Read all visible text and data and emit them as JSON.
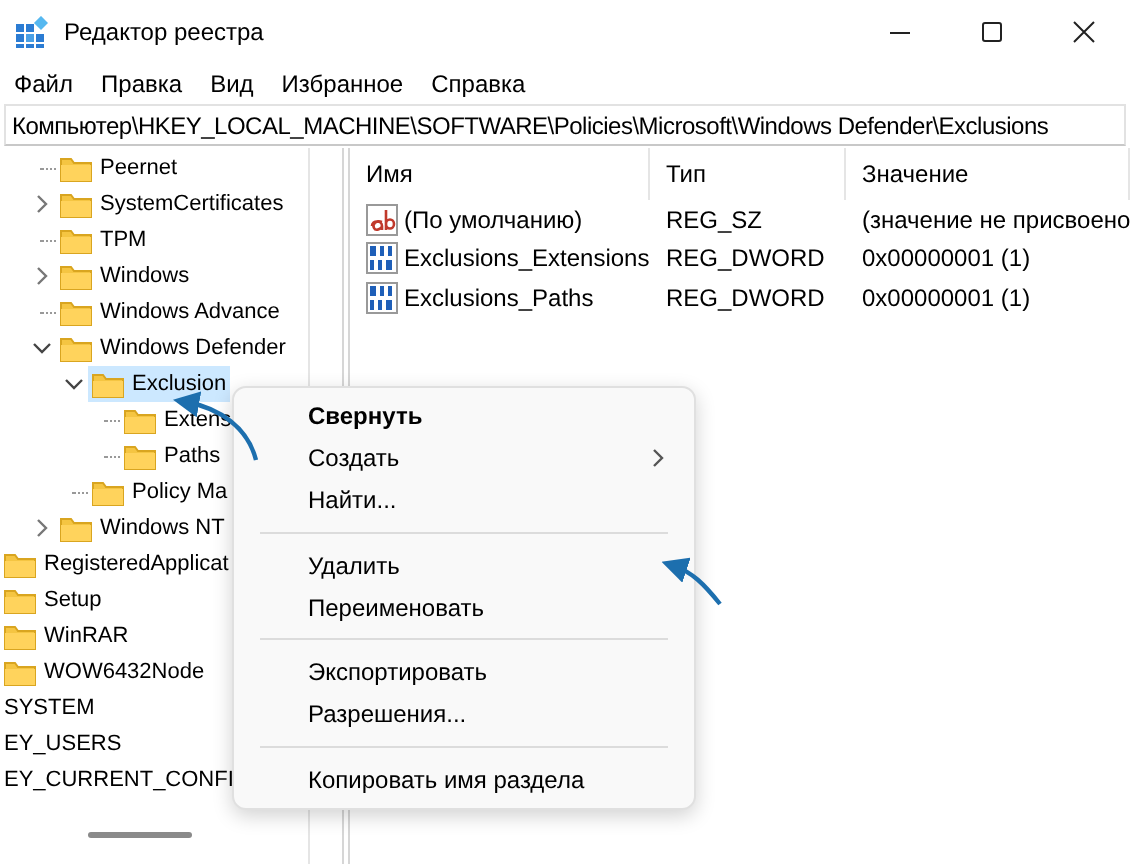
{
  "window": {
    "title": "Редактор реестра"
  },
  "menu_bar": [
    "Файл",
    "Правка",
    "Вид",
    "Избранное",
    "Справка"
  ],
  "address": "Компьютер\\HKEY_LOCAL_MACHINE\\SOFTWARE\\Policies\\Microsoft\\Windows Defender\\Exclusions",
  "tree": {
    "microsoft_keys": [
      {
        "label": "Peernet",
        "has_children": false,
        "selected": false
      },
      {
        "label": "SystemCertificates",
        "has_children": true,
        "expanded": false,
        "selected": false
      },
      {
        "label": "TPM",
        "has_children": false,
        "selected": false
      },
      {
        "label": "Windows",
        "has_children": true,
        "expanded": false,
        "selected": false
      },
      {
        "label": "Windows Advance",
        "has_children": false,
        "selected": false
      },
      {
        "label": "Windows Defender",
        "has_children": true,
        "expanded": true,
        "selected": false,
        "children": [
          {
            "label": "Exclusion",
            "has_children": true,
            "expanded": true,
            "selected": true,
            "children": [
              {
                "label": "Extens",
                "has_children": false,
                "selected": false
              },
              {
                "label": "Paths",
                "has_children": false,
                "selected": false
              }
            ]
          },
          {
            "label": "Policy Ma",
            "has_children": false,
            "selected": false
          }
        ]
      },
      {
        "label": "Windows NT",
        "has_children": true,
        "expanded": false,
        "selected": false
      }
    ],
    "software_keys": [
      {
        "label": "RegisteredApplicat",
        "selected": false
      },
      {
        "label": "Setup",
        "selected": false
      },
      {
        "label": "WinRAR",
        "selected": false
      },
      {
        "label": "WOW6432Node",
        "selected": false
      }
    ],
    "root_keys": [
      {
        "label": "SYSTEM",
        "selected": false
      },
      {
        "label": "EY_USERS",
        "selected": false
      },
      {
        "label": "EY_CURRENT_CONFI",
        "selected": false
      }
    ]
  },
  "values": {
    "columns": [
      "Имя",
      "Тип",
      "Значение"
    ],
    "rows": [
      {
        "kind": "string",
        "name": "(По умолчанию)",
        "type": "REG_SZ",
        "data": "(значение не присвоено"
      },
      {
        "kind": "dword",
        "name": "Exclusions_Extensions",
        "type": "REG_DWORD",
        "data": "0x00000001 (1)"
      },
      {
        "kind": "dword",
        "name": "Exclusions_Paths",
        "type": "REG_DWORD",
        "data": "0x00000001 (1)"
      }
    ]
  },
  "context_menu": [
    {
      "kind": "item",
      "label": "Свернуть",
      "default": true,
      "submenu": false
    },
    {
      "kind": "item",
      "label": "Создать",
      "default": false,
      "submenu": true
    },
    {
      "kind": "item",
      "label": "Найти...",
      "default": false,
      "submenu": false
    },
    {
      "kind": "separator"
    },
    {
      "kind": "item",
      "label": "Удалить",
      "default": false,
      "submenu": false
    },
    {
      "kind": "item",
      "label": "Переименовать",
      "default": false,
      "submenu": false
    },
    {
      "kind": "separator"
    },
    {
      "kind": "item",
      "label": "Экспортировать",
      "default": false,
      "submenu": false
    },
    {
      "kind": "item",
      "label": "Разрешения...",
      "default": false,
      "submenu": false
    },
    {
      "kind": "separator"
    },
    {
      "kind": "item",
      "label": "Копировать имя раздела",
      "default": false,
      "submenu": false
    }
  ]
}
